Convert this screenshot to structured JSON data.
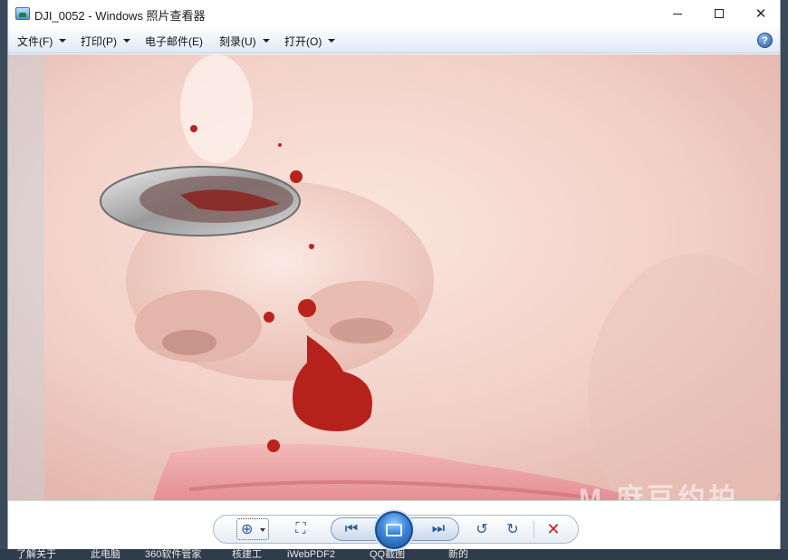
{
  "window": {
    "title": "DJI_0052 - Windows 照片查看器"
  },
  "menu": {
    "items": [
      {
        "label": "文件(F)",
        "has_dropdown": true
      },
      {
        "label": "打印(P)",
        "has_dropdown": true
      },
      {
        "label": "电子邮件(E)",
        "has_dropdown": false
      },
      {
        "label": "刻录(U)",
        "has_dropdown": true
      },
      {
        "label": "打开(O)",
        "has_dropdown": true
      }
    ],
    "help_glyph": "?"
  },
  "photo": {
    "subject": "close-up of nose with spoon and nosebleed",
    "watermark": "M 麻豆约拍"
  },
  "toolbar": {
    "zoom_glyph": "⊕",
    "fit_glyph": "⛶",
    "prev_glyph": "⏮",
    "next_glyph": "⏭",
    "rotate_ccw_glyph": "↺",
    "rotate_cw_glyph": "↻",
    "delete_glyph": "✕"
  },
  "desktop": {
    "labels": [
      "了解关于",
      "此电脑",
      "360软件管家",
      "核建工",
      "iWebPDF2",
      "QQ截图",
      "新的"
    ]
  },
  "colors": {
    "accent": "#2e5fa3",
    "delete": "#c8201c"
  }
}
